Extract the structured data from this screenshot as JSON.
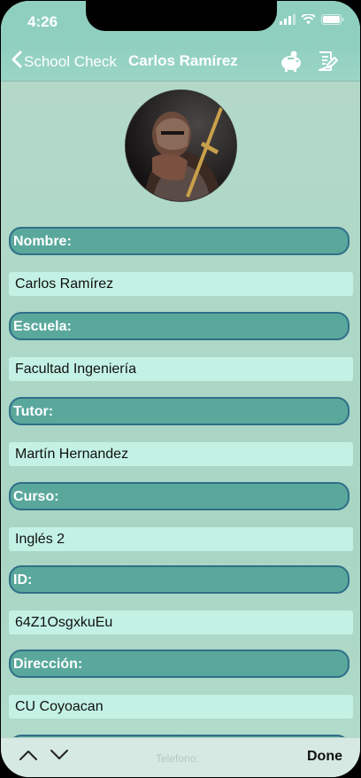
{
  "status_bar": {
    "time": "4:26"
  },
  "nav": {
    "back_label": "School Check",
    "title": "Carlos Ramírez"
  },
  "icons": {
    "back": "chevron-left-icon",
    "piggy": "piggy-bank-icon",
    "edit": "edit-document-icon",
    "wifi": "wifi-icon",
    "battery": "battery-icon",
    "up": "chevron-up-icon",
    "down": "chevron-down-icon"
  },
  "profile": {
    "avatar": "knight-avatar"
  },
  "fields": [
    {
      "label": "Nombre:",
      "value": "Carlos Ramírez"
    },
    {
      "label": "Escuela:",
      "value": "Facultad Ingeniería"
    },
    {
      "label": "Tutor:",
      "value": "Martín Hernandez"
    },
    {
      "label": "Curso:",
      "value": "Inglés 2"
    },
    {
      "label": "ID:",
      "value": "64Z1OsgxkuEu"
    },
    {
      "label": "Dirección:",
      "value": "CU Coyoacan"
    }
  ],
  "toolbar": {
    "field_label": "Telefono:",
    "done_label": "Done"
  },
  "colors": {
    "label_bg": "#5aa89c",
    "label_border": "#2f6f88",
    "value_bg": "#c3f2e4",
    "nav_bg": "#8fcfc0"
  }
}
